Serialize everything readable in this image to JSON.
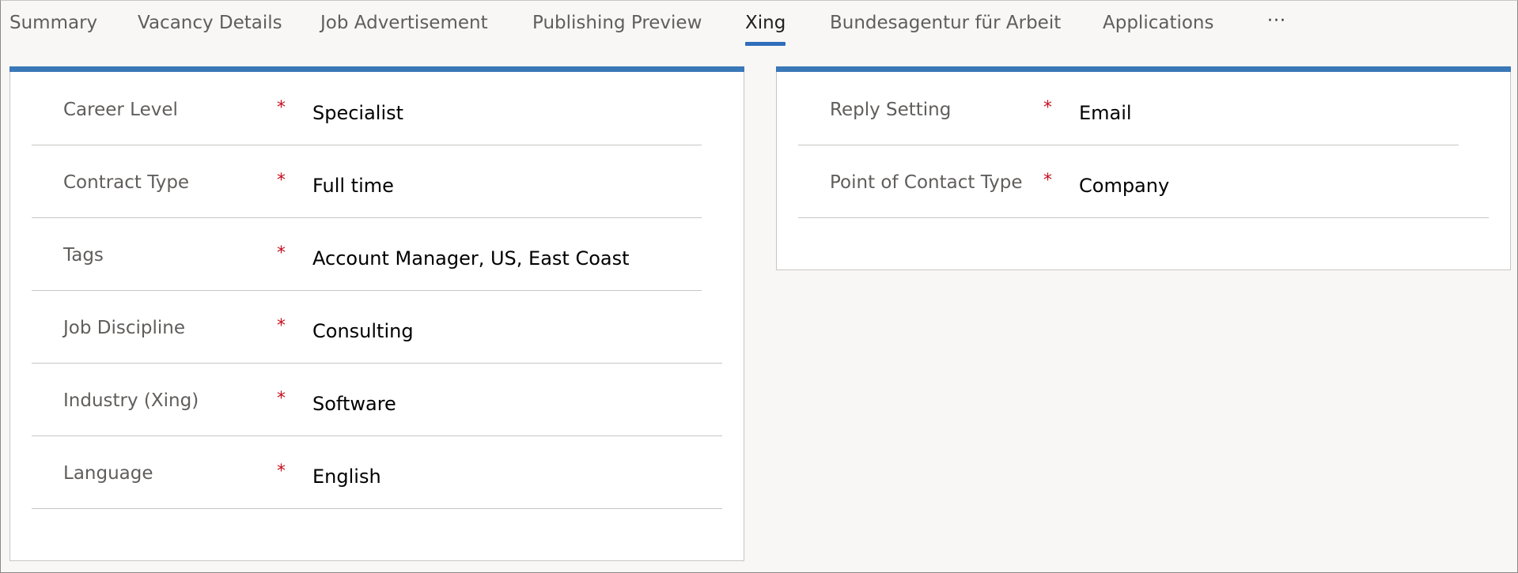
{
  "tabs": [
    {
      "label": "Summary",
      "active": false
    },
    {
      "label": "Vacancy Details",
      "active": false
    },
    {
      "label": "Job Advertisement",
      "active": false
    },
    {
      "label": "Publishing Preview",
      "active": false
    },
    {
      "label": "Xing",
      "active": true
    },
    {
      "label": "Bundesagentur für Arbeit",
      "active": false
    },
    {
      "label": "Applications",
      "active": false
    }
  ],
  "more_label": "···",
  "required_marker": "*",
  "left_panel": {
    "fields": [
      {
        "label": "Career Level",
        "value": "Specialist"
      },
      {
        "label": "Contract Type",
        "value": "Full time"
      },
      {
        "label": "Tags",
        "value": "Account Manager, US, East Coast"
      },
      {
        "label": "Job Discipline",
        "value": "Consulting"
      },
      {
        "label": "Industry (Xing)",
        "value": "Software"
      },
      {
        "label": "Language",
        "value": "English"
      }
    ]
  },
  "right_panel": {
    "fields": [
      {
        "label": "Reply Setting",
        "value": "Email"
      },
      {
        "label": "Point of Contact Type",
        "value": "Company"
      }
    ]
  },
  "colors": {
    "accent": "#2f6eba",
    "panel_top": "#3a78b7",
    "required": "#c50f1f",
    "label": "#605e5c"
  }
}
